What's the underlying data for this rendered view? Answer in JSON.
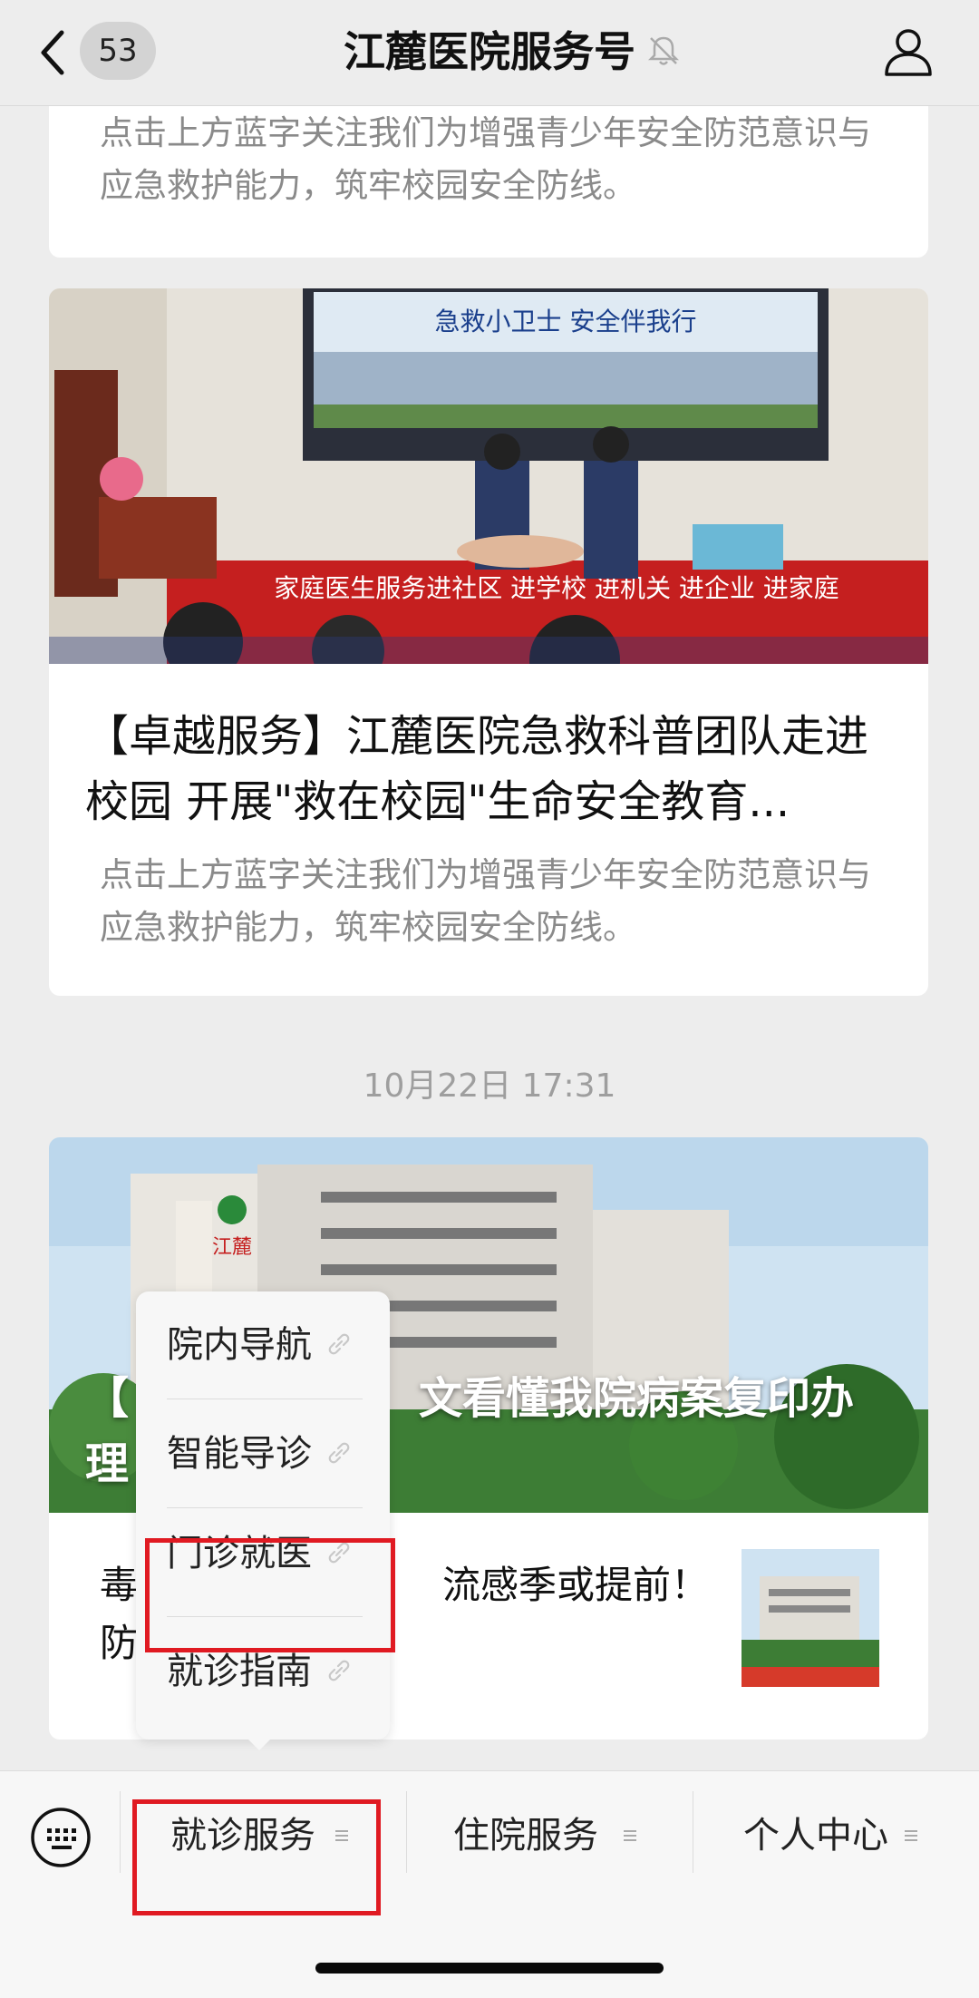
{
  "header": {
    "unread_count": "53",
    "title": "江麓医院服务号"
  },
  "articles": [
    {
      "summary": "点击上方蓝字关注我们为增强青少年安全防范意识与应急救护能力，筑牢校园安全防线。"
    },
    {
      "banner_text": "急救小卫士  安全伴我行",
      "table_banner_text": "家庭医生服务进社区 进学校 进机关 进企业 进家庭",
      "headline": "【卓越服务】江麓医院急救科普团队走进校园 开展\"救在校园\"生命安全教育...",
      "summary": "点击上方蓝字关注我们为增强青少年安全防范意识与应急救护能力，筑牢校园安全防线。"
    }
  ],
  "timestamp": "10月22日 17:31",
  "featured": {
    "overlay_title_visible": "【　　　　　文看懂我院病案复印办理",
    "overlay_line1_left": "【",
    "overlay_line1_right": "文看懂我院病案复印办",
    "overlay_line2_left": "理",
    "sub_left_1": "毒",
    "sub_right_1": "流感季或提前！",
    "sub_left_2": "防",
    "building_sign": "江麓"
  },
  "popup_menu": {
    "items": [
      "院内导航",
      "智能导诊",
      "门诊就医",
      "就诊指南"
    ]
  },
  "bottom_menu": {
    "tabs": [
      "就诊服务",
      "住院服务",
      "个人中心"
    ]
  },
  "colors": {
    "highlight": "#e01a22",
    "background": "#ededed"
  }
}
